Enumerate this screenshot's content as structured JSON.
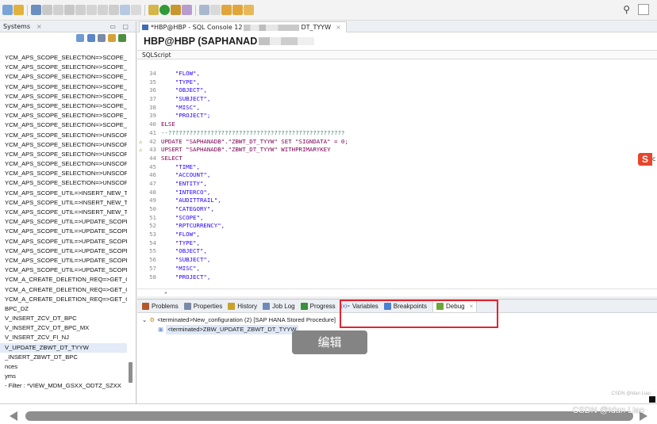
{
  "left_panel": {
    "tab_title": "Systems",
    "tab_close": "×",
    "window_buttons": "▭ ▢",
    "items": [
      "YCM_APS_SCOPE_SELECTION=>SCOPE_C",
      "YCM_APS_SCOPE_SELECTION=>SCOPE_C",
      "YCM_APS_SCOPE_SELECTION=>SCOPE_C",
      "YCM_APS_SCOPE_SELECTION=>SCOPE_C",
      "YCM_APS_SCOPE_SELECTION=>SCOPE_C",
      "YCM_APS_SCOPE_SELECTION=>SCOPE_U",
      "YCM_APS_SCOPE_SELECTION=>SCOPE_U",
      "YCM_APS_SCOPE_SELECTION=>SCOPE_U",
      "YCM_APS_SCOPE_SELECTION=>UNSCOP",
      "YCM_APS_SCOPE_SELECTION=>UNSCOP",
      "YCM_APS_SCOPE_SELECTION=>UNSCOP",
      "YCM_APS_SCOPE_SELECTION=>UNSCOP",
      "YCM_APS_SCOPE_SELECTION=>UNSCOP",
      "YCM_APS_SCOPE_SELECTION=>UNSCOP",
      "YCM_APS_SCOPE_UTIL=>INSERT_NEW_T/",
      "YCM_APS_SCOPE_UTIL=>INSERT_NEW_T/",
      "YCM_APS_SCOPE_UTIL=>INSERT_NEW_T/",
      "YCM_APS_SCOPE_UTIL=>UPDATE_SCOPE",
      "YCM_APS_SCOPE_UTIL=>UPDATE_SCOPE",
      "YCM_APS_SCOPE_UTIL=>UPDATE_SCOPE",
      "YCM_APS_SCOPE_UTIL=>UPDATE_SCOPE",
      "YCM_APS_SCOPE_UTIL=>UPDATE_SCOPE",
      "YCM_APS_SCOPE_UTIL=>UPDATE_SCOPE",
      "YCM_A_CREATE_DELETION_REQ=>GET_O",
      "YCM_A_CREATE_DELETION_REQ=>GET_O",
      "YCM_A_CREATE_DELETION_REQ=>GET_O",
      "BPC_DZ",
      "V_INSERT_ZCV_DT_BPC",
      "V_INSERT_ZCV_DT_BPC_MX",
      "V_INSERT_ZCV_FI_NJ",
      "V_UPDATE_ZBWT_DT_TYYW",
      "_INSERT_ZBWT_DT_BPC",
      "nces",
      "yms",
      "- Filter : *VIEW_MDM_GSXX_ODTZ_SZXX"
    ],
    "selected_index": 30
  },
  "editor": {
    "tab_prefix": "*HBP@HBP - SQL Console 12",
    "tab_suffix": "DT_TYYW",
    "tab_close": "×",
    "header_title": "HBP@HBP (SAPHANAD",
    "subtab": "SQLScript",
    "scroll_marker": "◂",
    "lines": [
      {
        "n": "34",
        "text": "    \"FLOW\",",
        "cls": "str"
      },
      {
        "n": "35",
        "text": "    \"TYPE\",",
        "cls": "str"
      },
      {
        "n": "36",
        "text": "    \"OBJECT\",",
        "cls": "str"
      },
      {
        "n": "37",
        "text": "    \"SUBJECT\",",
        "cls": "str"
      },
      {
        "n": "38",
        "text": "    \"MISC\",",
        "cls": "str"
      },
      {
        "n": "39",
        "text": "    \"PROJECT\";",
        "cls": "str"
      },
      {
        "n": "40",
        "text": "ELSE",
        "cls": "kw"
      },
      {
        "n": "41",
        "text": "--??????????????????????????????????????????????????",
        "cls": "cm"
      },
      {
        "n": "42",
        "text": "UPDATE \"SAPHANADB\".\"ZBWT_DT_TYYW\" SET \"SIGNDATA\" = 0;",
        "cls": "kw",
        "mark": "⚠"
      },
      {
        "n": "43",
        "text": "UPSERT \"SAPHANADB\".\"ZBWT_DT_TYYW\" WITHPRIMARYKEY",
        "cls": "kw",
        "mark": "⚠"
      },
      {
        "n": "44",
        "text": "SELECT",
        "cls": "kw"
      },
      {
        "n": "45",
        "text": "    \"TIME\",",
        "cls": "str"
      },
      {
        "n": "46",
        "text": "    \"ACCOUNT\",",
        "cls": "str"
      },
      {
        "n": "47",
        "text": "    \"ENTITY\",",
        "cls": "str"
      },
      {
        "n": "48",
        "text": "    \"INTERCO\",",
        "cls": "str"
      },
      {
        "n": "49",
        "text": "    \"AUDITTRAIL\",",
        "cls": "str"
      },
      {
        "n": "50",
        "text": "    \"CATEGORY\",",
        "cls": "str"
      },
      {
        "n": "51",
        "text": "    \"SCOPE\",",
        "cls": "str"
      },
      {
        "n": "52",
        "text": "    \"RPTCURRENCY\",",
        "cls": "str"
      },
      {
        "n": "53",
        "text": "    \"FLOW\",",
        "cls": "str"
      },
      {
        "n": "54",
        "text": "    \"TYPE\",",
        "cls": "str"
      },
      {
        "n": "55",
        "text": "    \"OBJECT\",",
        "cls": "str"
      },
      {
        "n": "56",
        "text": "    \"SUBJECT\",",
        "cls": "str"
      },
      {
        "n": "57",
        "text": "    \"MISC\",",
        "cls": "str"
      },
      {
        "n": "58",
        "text": "    \"PROJECT\",",
        "cls": "str"
      }
    ]
  },
  "ime_badge": {
    "label": "S",
    "tail": "c"
  },
  "bottom_panel": {
    "tabs": [
      {
        "label": "Problems",
        "icon_color": "#b2572b"
      },
      {
        "label": "Properties",
        "icon_color": "#7a8aa6"
      },
      {
        "label": "History",
        "icon_color": "#c9a227"
      },
      {
        "label": "Job Log",
        "icon_color": "#6f8ab8"
      },
      {
        "label": "Progress",
        "icon_color": "#3b8f3b"
      },
      {
        "label": "Variables",
        "icon_color": "#3a63b8",
        "prefix": "(x)="
      },
      {
        "label": "Breakpoints",
        "icon_color": "#4a7fd4"
      },
      {
        "label": "Debug",
        "icon_color": "#6fa43a",
        "active": true
      }
    ],
    "debug_tab_close": "×",
    "tree": {
      "root": "<terminated>New_configuration (2) [SAP HANA Stored Procedure]",
      "child": "<terminated>ZBW_UPDATE_ZBWT_DT_TYYW"
    },
    "edit_button": "编辑",
    "watermark_small": "CSDN @Idan Liao"
  },
  "footer": {
    "watermark": "CSDN @Idan Liao"
  },
  "colors": {
    "highlight_box": "#e0242f",
    "keyword": "#7f0055",
    "string": "#2a00ff",
    "comment": "#3f7f5f",
    "ime_badge": "#e8452c"
  }
}
